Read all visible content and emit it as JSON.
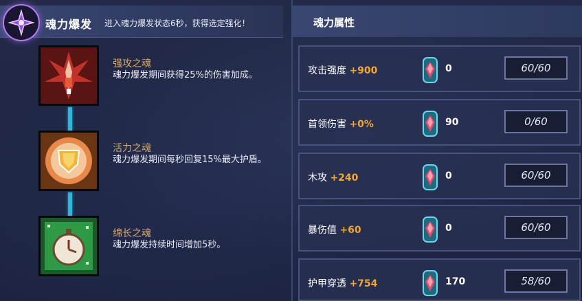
{
  "header": {
    "title": "魂力爆发",
    "description": "进入魂力爆发状态6秒，获得选定强化！",
    "icon": "burst-rune-icon"
  },
  "skills": [
    {
      "name": "强攻之魂",
      "desc": "魂力爆发期间获得25%的伤害加成。",
      "icon": "red-spikes-icon"
    },
    {
      "name": "活力之魂",
      "desc": "魂力爆发期间每秒回复15%最大护盾。",
      "icon": "gold-shield-icon"
    },
    {
      "name": "绵长之魂",
      "desc": "魂力爆发持续时间增加5秒。",
      "icon": "green-stopwatch-icon"
    }
  ],
  "attributes": {
    "title": "魂力属性",
    "rows": [
      {
        "name": "攻击强度",
        "bonus": "+900",
        "gems": "0",
        "progress": "60/60"
      },
      {
        "name": "首领伤害",
        "bonus": "+0%",
        "gems": "90",
        "progress": "0/60"
      },
      {
        "name": "木攻",
        "bonus": "+240",
        "gems": "0",
        "progress": "60/60"
      },
      {
        "name": "暴伤值",
        "bonus": "+60",
        "gems": "0",
        "progress": "60/60"
      },
      {
        "name": "护甲穿透",
        "bonus": "+754",
        "gems": "170",
        "progress": "58/60"
      }
    ]
  },
  "colors": {
    "accent_orange": "#f0a534",
    "skill_name": "#d9a96a",
    "connector": "#2fb6d8"
  }
}
